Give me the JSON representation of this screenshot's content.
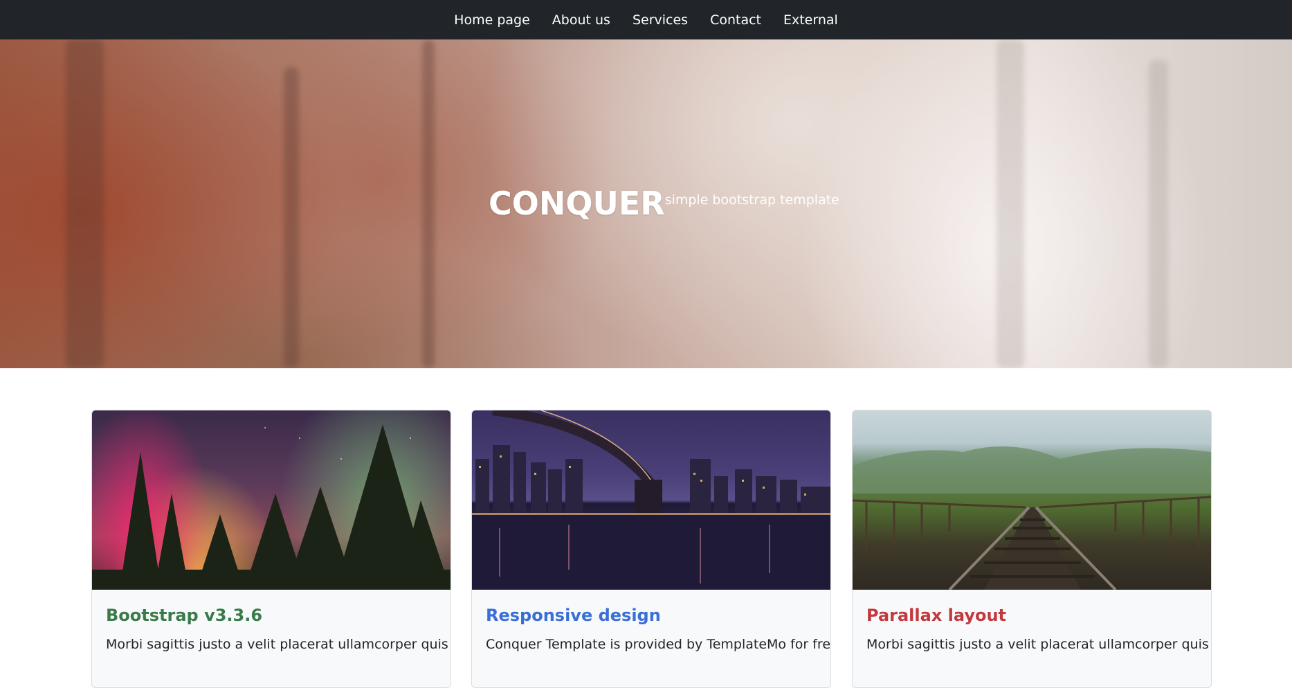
{
  "nav": {
    "items": [
      {
        "label": "Home page"
      },
      {
        "label": "About us"
      },
      {
        "label": "Services"
      },
      {
        "label": "Contact"
      },
      {
        "label": "External"
      }
    ]
  },
  "hero": {
    "title": "CONQUER",
    "subtitle": "simple bootstrap template"
  },
  "cards": [
    {
      "title": "Bootstrap v3.3.6",
      "text": "Morbi sagittis justo a velit placerat ullamcorper quis",
      "title_color": "#3b7a4b"
    },
    {
      "title": "Responsive design",
      "text": "Conquer Template is provided by TemplateMo for free",
      "title_color": "#3a6fd8"
    },
    {
      "title": "Parallax layout",
      "text": "Morbi sagittis justo a velit placerat ullamcorper quis",
      "title_color": "#c2393d"
    }
  ]
}
